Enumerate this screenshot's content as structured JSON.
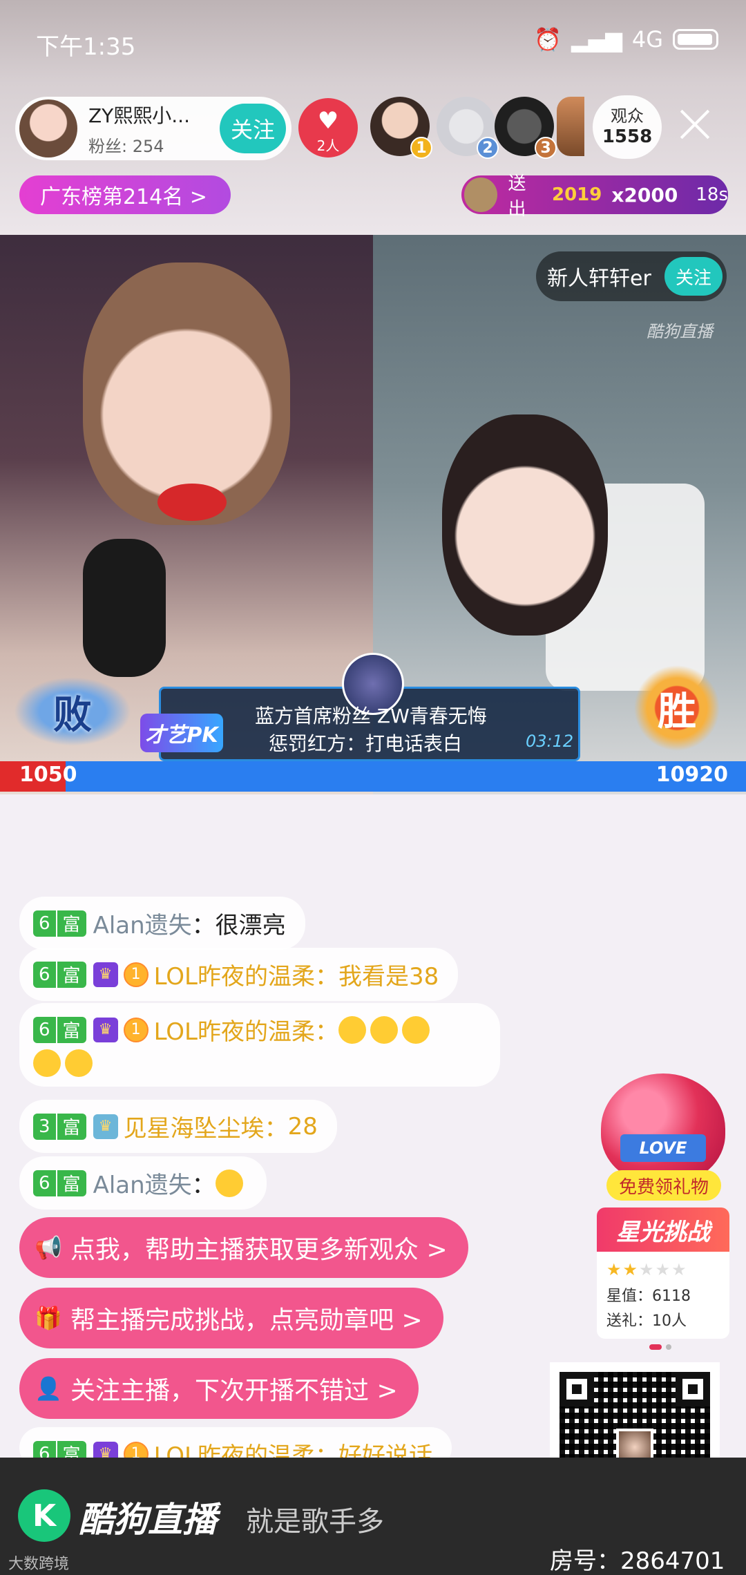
{
  "status_bar": {
    "time": "下午1:35",
    "network": "4G"
  },
  "header": {
    "anchor_name": "ZY熙熙小...",
    "anchor_fans": "粉丝: 254",
    "follow_label": "关注",
    "guard_count": "2人",
    "rank_numbers": [
      "1",
      "2",
      "3"
    ],
    "viewers_label": "观众",
    "viewers_count": "1558",
    "rank_pill": "广东榜第214名 >",
    "gift_banner": {
      "sent_label": "送出",
      "count": "x2000",
      "timer": "18s"
    }
  },
  "video": {
    "right_anchor_name": "新人轩轩er",
    "right_follow_label": "关注",
    "watermark": "酷狗直播",
    "lose_label": "败",
    "win_label": "胜",
    "pk_logo": "才艺PK",
    "pk_line1": "蓝方首席粉丝 ZW青春无悔",
    "pk_line2": "惩罚红方：打电话表白",
    "pk_timer": "03:12",
    "score_left": "1050",
    "score_right": "10920"
  },
  "chat": {
    "messages": [
      {
        "level": "6",
        "rich": "富",
        "user": "Alan遗失",
        "text": "很漂亮"
      },
      {
        "level": "6",
        "rich": "富",
        "medal": "1",
        "user": "LOL昨夜的温柔",
        "text": "我看是38"
      },
      {
        "level": "6",
        "rich": "富",
        "medal": "1",
        "user": "LOL昨夜的温柔",
        "text": ""
      },
      {
        "level": "3",
        "rich": "富",
        "user": "见星海坠尘埃",
        "text": "28"
      },
      {
        "level": "6",
        "rich": "富",
        "user": "Alan遗失",
        "text": ""
      },
      {
        "level": "6",
        "rich": "富",
        "medal": "1",
        "user": "LOL昨夜的温柔",
        "text": "好好说话"
      }
    ],
    "separator": "：",
    "prompts": [
      "点我，帮助主播获取更多新观众 >",
      "帮主播完成挑战，点亮勋章吧 >",
      "关注主播，下次开播不错过 >"
    ]
  },
  "side": {
    "love_ribbon": "LOVE",
    "love_label": "免费领礼物",
    "star_title": "星光挑战",
    "star_value": "星值：6118",
    "star_gift": "送礼：10人"
  },
  "bottom": {
    "brand": "酷狗直播",
    "slogan": "就是歌手多",
    "room_no": "房号：2864701",
    "watermark": "大数跨境"
  }
}
